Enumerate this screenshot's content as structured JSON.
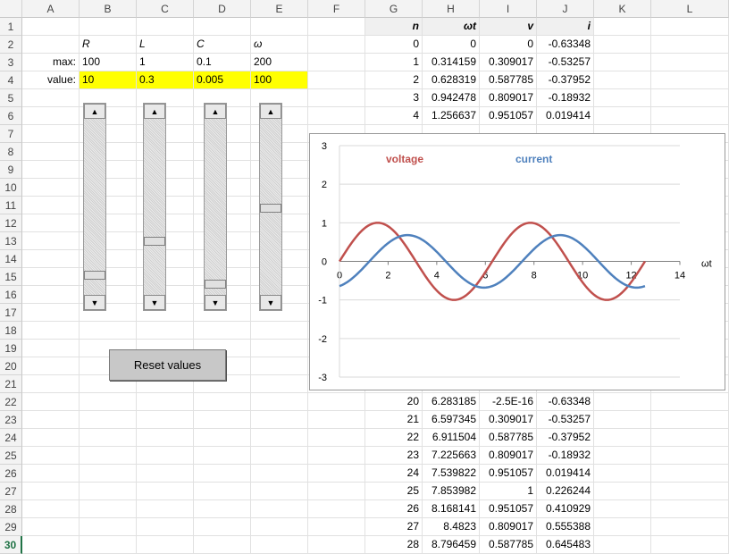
{
  "columns": [
    "A",
    "B",
    "C",
    "D",
    "E",
    "F",
    "G",
    "H",
    "I",
    "J",
    "K",
    "L"
  ],
  "rows": [
    "1",
    "2",
    "3",
    "4",
    "5",
    "6",
    "7",
    "8",
    "9",
    "10",
    "11",
    "12",
    "13",
    "14",
    "15",
    "16",
    "17",
    "18",
    "19",
    "20",
    "21",
    "22",
    "23",
    "24",
    "25",
    "26",
    "27",
    "28",
    "29",
    "30"
  ],
  "active_row": "30",
  "params": {
    "headers": [
      "R",
      "L",
      "C",
      "ω"
    ],
    "max_label": "max:",
    "value_label": "value:",
    "max": [
      "100",
      "1",
      "0.1",
      "200"
    ],
    "value": [
      "10",
      "0.3",
      "0.005",
      "100"
    ]
  },
  "sliders": [
    {
      "name": "R",
      "level": 0.1
    },
    {
      "name": "L",
      "level": 0.3
    },
    {
      "name": "C",
      "level": 0.05
    },
    {
      "name": "omega",
      "level": 0.5
    }
  ],
  "reset_button": "Reset values",
  "table": {
    "headers": [
      "n",
      "ωt",
      "v",
      "i"
    ],
    "top_rows": [
      [
        "0",
        "0",
        "0",
        "-0.63348"
      ],
      [
        "1",
        "0.314159",
        "0.309017",
        "-0.53257"
      ],
      [
        "2",
        "0.628319",
        "0.587785",
        "-0.37952"
      ],
      [
        "3",
        "0.942478",
        "0.809017",
        "-0.18932"
      ],
      [
        "4",
        "1.256637",
        "0.951057",
        "0.019414"
      ]
    ],
    "bottom_rows": [
      [
        "20",
        "6.283185",
        "-2.5E-16",
        "-0.63348"
      ],
      [
        "21",
        "6.597345",
        "0.309017",
        "-0.53257"
      ],
      [
        "22",
        "6.911504",
        "0.587785",
        "-0.37952"
      ],
      [
        "23",
        "7.225663",
        "0.809017",
        "-0.18932"
      ],
      [
        "24",
        "7.539822",
        "0.951057",
        "0.019414"
      ],
      [
        "25",
        "7.853982",
        "1",
        "0.226244"
      ],
      [
        "26",
        "8.168141",
        "0.951057",
        "0.410929"
      ],
      [
        "27",
        "8.4823",
        "0.809017",
        "0.555388"
      ],
      [
        "28",
        "8.796459",
        "0.587785",
        "0.645483"
      ]
    ]
  },
  "chart_data": {
    "type": "line",
    "x_label": "ωt",
    "xlim": [
      0,
      14
    ],
    "ylim": [
      -3,
      3
    ],
    "x_ticks": [
      "0",
      "2",
      "4",
      "6",
      "8",
      "10",
      "12",
      "14"
    ],
    "y_ticks": [
      "3",
      "2",
      "1",
      "0",
      "-1",
      "-2",
      "-3"
    ],
    "grid": true,
    "series": [
      {
        "name": "voltage",
        "color": "#c0504d",
        "amplitude": 1,
        "phase": 0
      },
      {
        "name": "current",
        "color": "#4f81bd",
        "amplitude": 0.68,
        "phase": -1.23
      }
    ],
    "x_end": 12.566
  }
}
